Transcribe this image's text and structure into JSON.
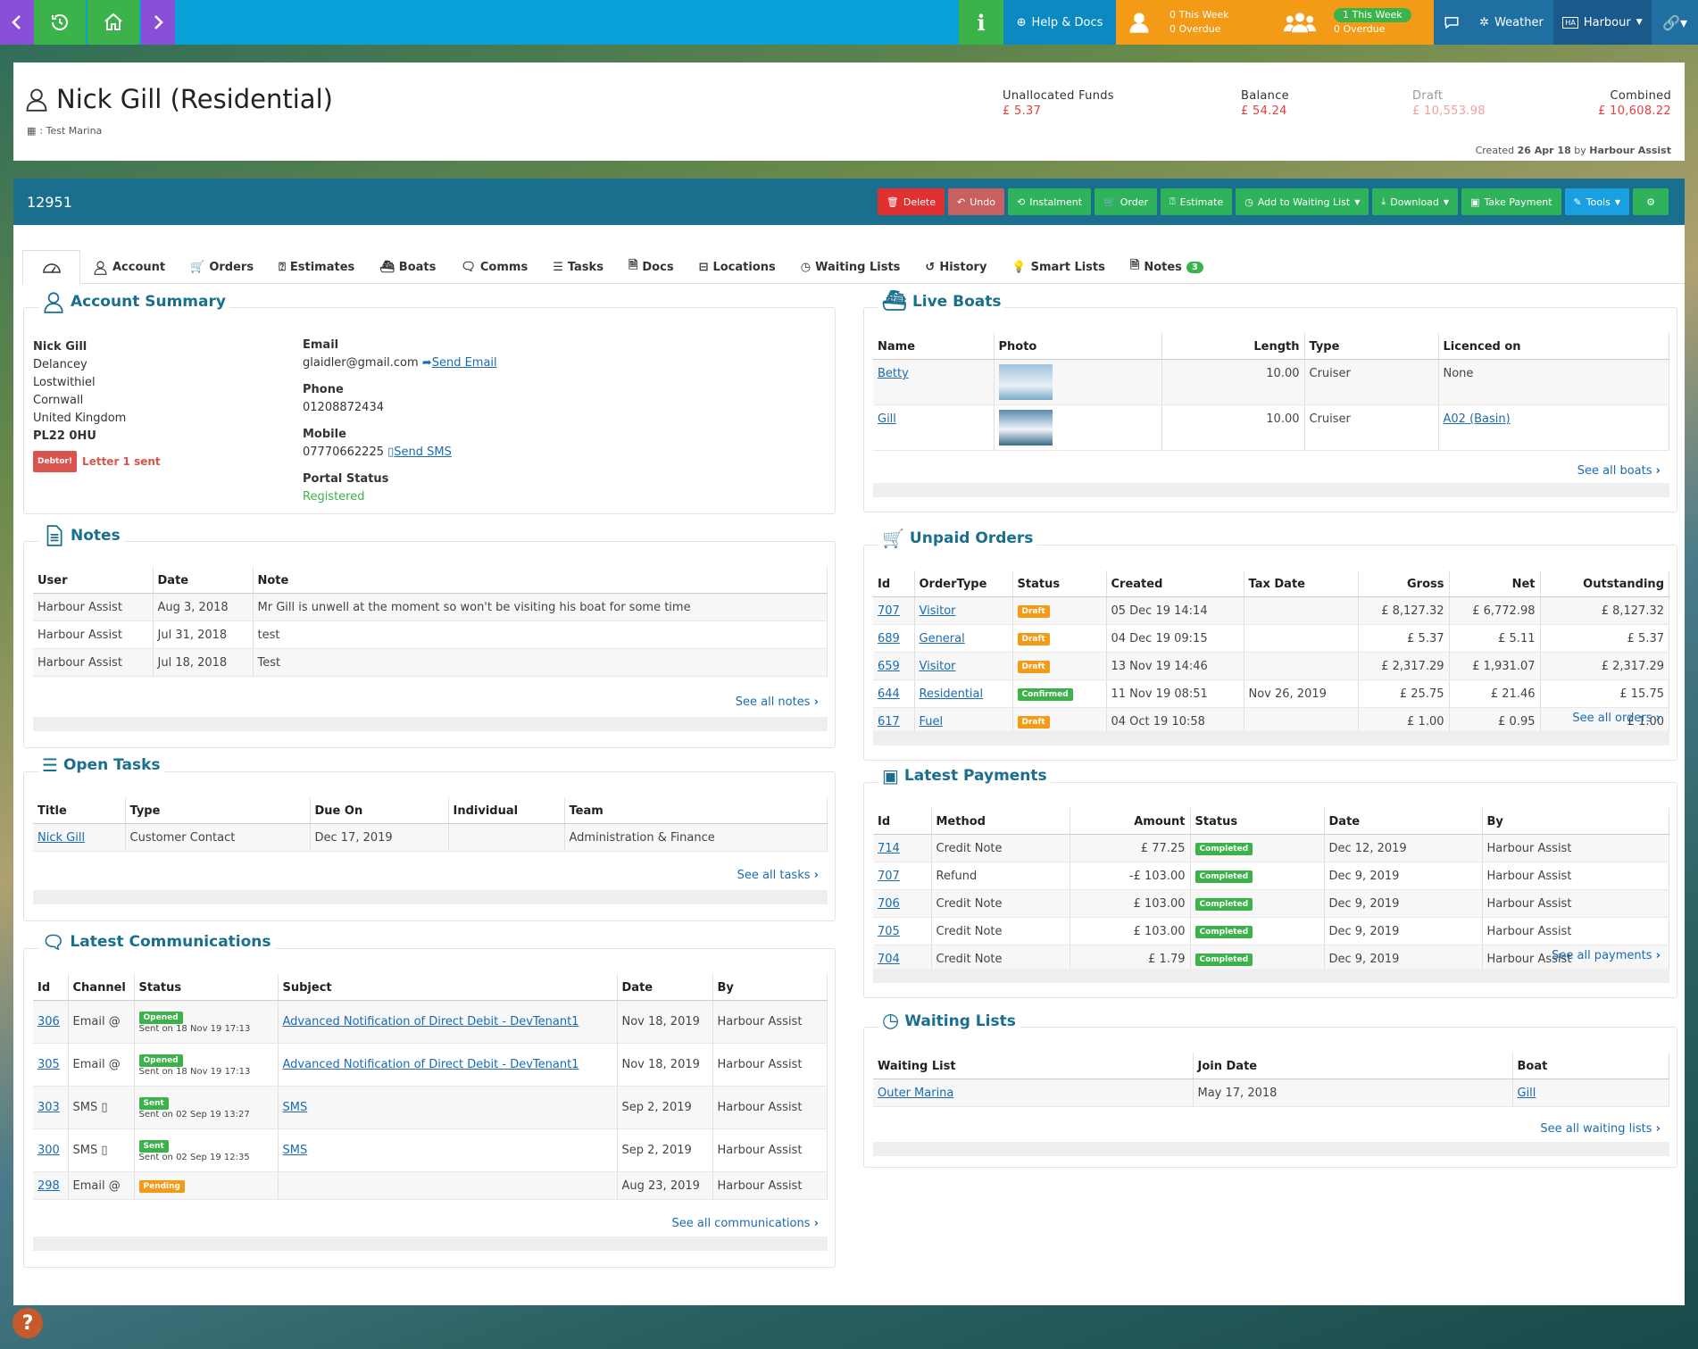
{
  "topbar": {
    "help": "Help & Docs",
    "my_week": "0 This Week",
    "my_overdue": "0 Overdue",
    "team_week": "1 This Week",
    "team_overdue": "0 Overdue",
    "weather": "Weather",
    "harbour": "Harbour"
  },
  "customer": {
    "name": "Nick Gill (Residential)",
    "marina": ": Test Marina",
    "unallocated_label": "Unallocated Funds",
    "unallocated": "£ 5.37",
    "balance_label": "Balance",
    "balance": "£ 54.24",
    "draft_label": "Draft",
    "draft": "£ 10,553.98",
    "combined_label": "Combined",
    "combined": "£ 10,608.22",
    "created_prefix": "Created",
    "created_date": "26 Apr 18",
    "created_by_prefix": "by",
    "created_by": "Harbour Assist"
  },
  "account_id": "12951",
  "actions": {
    "delete": "Delete",
    "undo": "Undo",
    "instalment": "Instalment",
    "order": "Order",
    "estimate": "Estimate",
    "waiting": "Add to Waiting List",
    "download": "Download",
    "payment": "Take Payment",
    "tools": "Tools"
  },
  "tabs": [
    "Account",
    "Orders",
    "Estimates",
    "Boats",
    "Comms",
    "Tasks",
    "Docs",
    "Locations",
    "Waiting Lists",
    "History",
    "Smart Lists",
    "Notes"
  ],
  "notes_count": "3",
  "summary": {
    "title": "Account Summary",
    "name": "Nick Gill",
    "addr1": "Delancey",
    "addr2": "Lostwithiel",
    "addr3": "Cornwall",
    "addr4": "United Kingdom",
    "postcode": "PL22 0HU",
    "debtor": "Debtor!",
    "letter": "Letter 1 sent",
    "email_label": "Email",
    "email": "glaidler@gmail.com",
    "send_email": "Send Email",
    "phone_label": "Phone",
    "phone": "01208872434",
    "mobile_label": "Mobile",
    "mobile": "07770662225",
    "send_sms": "Send SMS",
    "portal_label": "Portal Status",
    "portal": "Registered"
  },
  "notes": {
    "title": "Notes",
    "headers": [
      "User",
      "Date",
      "Note"
    ],
    "rows": [
      [
        "Harbour Assist",
        "Aug 3, 2018",
        "Mr Gill is unwell at the moment so won't be visiting his boat for some time"
      ],
      [
        "Harbour Assist",
        "Jul 31, 2018",
        "test"
      ],
      [
        "Harbour Assist",
        "Jul 18, 2018",
        "Test"
      ]
    ],
    "see": "See all notes"
  },
  "tasks": {
    "title": "Open Tasks",
    "headers": [
      "Title",
      "Type",
      "Due On",
      "Individual",
      "Team"
    ],
    "rows": [
      [
        "Nick Gill",
        "Customer Contact",
        "Dec 17, 2019",
        "",
        "Administration & Finance"
      ]
    ],
    "see": "See all tasks"
  },
  "comms": {
    "title": "Latest Communications",
    "headers": [
      "Id",
      "Channel",
      "Status",
      "Subject",
      "Date",
      "By"
    ],
    "rows": [
      {
        "id": "306",
        "ch": "Email @",
        "st": "Opened",
        "sent": "Sent on 18 Nov 19 17:13",
        "subj": "Advanced Notification of Direct Debit - DevTenant1",
        "date": "Nov 18, 2019",
        "by": "Harbour Assist"
      },
      {
        "id": "305",
        "ch": "Email @",
        "st": "Opened",
        "sent": "Sent on 18 Nov 19 17:13",
        "subj": "Advanced Notification of Direct Debit - DevTenant1",
        "date": "Nov 18, 2019",
        "by": "Harbour Assist"
      },
      {
        "id": "303",
        "ch": "SMS ▯",
        "st": "Sent",
        "sent": "Sent on 02 Sep 19 13:27",
        "subj": "SMS",
        "date": "Sep 2, 2019",
        "by": "Harbour Assist"
      },
      {
        "id": "300",
        "ch": "SMS ▯",
        "st": "Sent",
        "sent": "Sent on 02 Sep 19 12:35",
        "subj": "SMS",
        "date": "Sep 2, 2019",
        "by": "Harbour Assist"
      },
      {
        "id": "298",
        "ch": "Email @",
        "st": "Pending",
        "sent": "",
        "subj": "",
        "date": "Aug 23, 2019",
        "by": "Harbour Assist"
      }
    ],
    "see": "See all communications"
  },
  "boats": {
    "title": "Live Boats",
    "headers": [
      "Name",
      "Photo",
      "Length",
      "Type",
      "Licenced on"
    ],
    "rows": [
      [
        "Betty",
        "",
        "10.00",
        "Cruiser",
        "None"
      ],
      [
        "Gill",
        "",
        "10.00",
        "Cruiser",
        "A02 (Basin)"
      ]
    ],
    "see": "See all boats"
  },
  "orders": {
    "title": "Unpaid Orders",
    "headers": [
      "Id",
      "OrderType",
      "Status",
      "Created",
      "Tax Date",
      "Gross",
      "Net",
      "Outstanding"
    ],
    "rows": [
      [
        "707",
        "Visitor",
        "Draft",
        "05 Dec 19 14:14",
        "",
        "£ 8,127.32",
        "£ 6,772.98",
        "£ 8,127.32"
      ],
      [
        "689",
        "General",
        "Draft",
        "04 Dec 19 09:15",
        "",
        "£ 5.37",
        "£ 5.11",
        "£ 5.37"
      ],
      [
        "659",
        "Visitor",
        "Draft",
        "13 Nov 19 14:46",
        "",
        "£ 2,317.29",
        "£ 1,931.07",
        "£ 2,317.29"
      ],
      [
        "644",
        "Residential",
        "Confirmed",
        "11 Nov 19 08:51",
        "Nov 26, 2019",
        "£ 25.75",
        "£ 21.46",
        "£ 15.75"
      ],
      [
        "617",
        "Fuel",
        "Draft",
        "04 Oct 19 10:58",
        "",
        "£ 1.00",
        "£ 0.95",
        "£ 1.00"
      ]
    ],
    "see": "See all orders"
  },
  "payments": {
    "title": "Latest Payments",
    "headers": [
      "Id",
      "Method",
      "Amount",
      "Status",
      "Date",
      "By"
    ],
    "rows": [
      [
        "714",
        "Credit Note",
        "£ 77.25",
        "Completed",
        "Dec 12, 2019",
        "Harbour Assist"
      ],
      [
        "707",
        "Refund",
        "-£ 103.00",
        "Completed",
        "Dec 9, 2019",
        "Harbour Assist"
      ],
      [
        "706",
        "Credit Note",
        "£ 103.00",
        "Completed",
        "Dec 9, 2019",
        "Harbour Assist"
      ],
      [
        "705",
        "Credit Note",
        "£ 103.00",
        "Completed",
        "Dec 9, 2019",
        "Harbour Assist"
      ],
      [
        "704",
        "Credit Note",
        "£ 1.79",
        "Completed",
        "Dec 9, 2019",
        "Harbour Assist"
      ]
    ],
    "see": "See all payments"
  },
  "waiting": {
    "title": "Waiting Lists",
    "headers": [
      "Waiting List",
      "Join Date",
      "Boat"
    ],
    "rows": [
      [
        "Outer Marina",
        "May 17, 2018",
        "Gill"
      ]
    ],
    "see": "See all waiting lists"
  }
}
